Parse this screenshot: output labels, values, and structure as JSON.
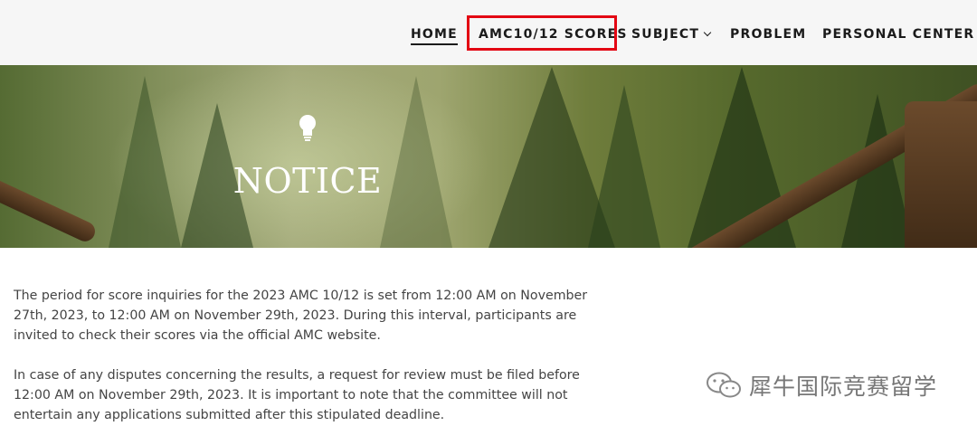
{
  "nav": {
    "items": [
      {
        "label": "HOME",
        "dropdown": false,
        "active": true
      },
      {
        "label": "AMC10/12 SCORES",
        "dropdown": false,
        "active": false
      },
      {
        "label": "SUBJECT",
        "dropdown": true,
        "active": false
      },
      {
        "label": "PROBLEM",
        "dropdown": false,
        "active": false
      },
      {
        "label": "PERSONAL CENTER",
        "dropdown": true,
        "active": false
      }
    ],
    "highlight_color": "#e30613"
  },
  "hero": {
    "title": "NOTICE",
    "icon": "lightbulb-icon"
  },
  "content": {
    "paragraphs": [
      "The period for score inquiries for the 2023 AMC 10/12 is set from 12:00 AM on November 27th, 2023, to 12:00 AM on November 29th, 2023. During this interval, participants are invited to check their scores via the official AMC website.",
      "In case of any disputes concerning the results, a request for review must be filed before 12:00 AM on November 29th, 2023. It is important to note that the committee will not entertain any applications submitted after this stipulated deadline."
    ]
  },
  "watermark": {
    "text": "犀牛国际竞赛留学",
    "icon": "wechat-icon"
  }
}
